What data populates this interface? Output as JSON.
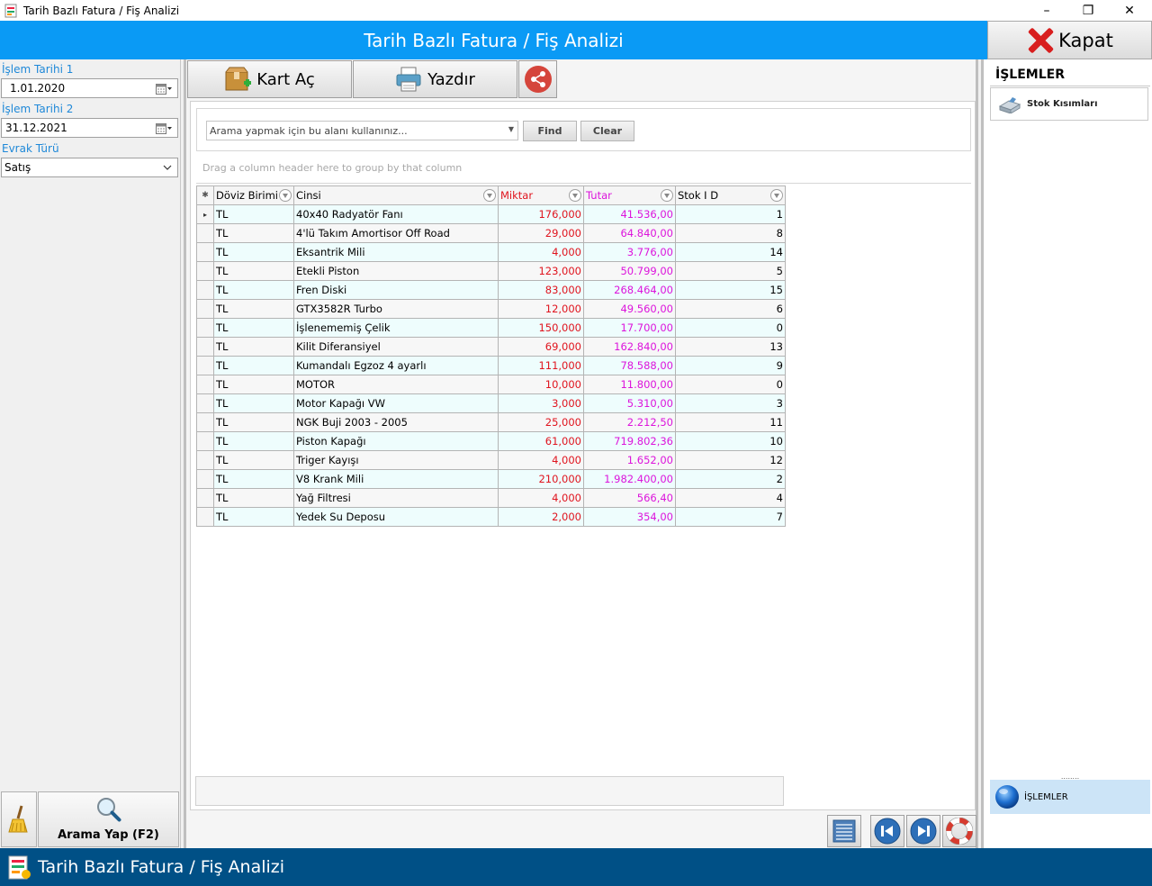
{
  "window": {
    "title": "Tarih Bazlı Fatura / Fiş Analizi",
    "minimize": "–",
    "restore": "❐",
    "close": "✕"
  },
  "header": {
    "title": "Tarih Bazlı Fatura / Fiş Analizi",
    "close_label": "Kapat"
  },
  "filters": {
    "date1_label": "İşlem Tarihi 1",
    "date1_value": "1.01.2020",
    "date2_label": "İşlem Tarihi 2",
    "date2_value": "31.12.2021",
    "doc_type_label": "Evrak Türü",
    "doc_type_value": "Satış",
    "search_button": "Arama Yap (F2)"
  },
  "toolbar": {
    "open_card": "Kart Aç",
    "print": "Yazdır"
  },
  "find_panel": {
    "placeholder": "Arama yapmak için bu alanı kullanınız...",
    "find": "Find",
    "clear": "Clear"
  },
  "group_panel": {
    "hint": "Drag a column header here to group by that column"
  },
  "grid": {
    "columns": [
      "Döviz Birimi",
      "Cinsi",
      "Miktar",
      "Tutar",
      "Stok I D"
    ],
    "rows": [
      [
        "TL",
        "40x40 Radyatör Fanı",
        "176,000",
        "41.536,00",
        "1"
      ],
      [
        "TL",
        "4'lü Takım Amortisor Off Road",
        "29,000",
        "64.840,00",
        "8"
      ],
      [
        "TL",
        "Eksantrik Mili",
        "4,000",
        "3.776,00",
        "14"
      ],
      [
        "TL",
        "Etekli Piston",
        "123,000",
        "50.799,00",
        "5"
      ],
      [
        "TL",
        "Fren Diski",
        "83,000",
        "268.464,00",
        "15"
      ],
      [
        "TL",
        "GTX3582R Turbo",
        "12,000",
        "49.560,00",
        "6"
      ],
      [
        "TL",
        "İşlenememiş Çelik",
        "150,000",
        "17.700,00",
        "0"
      ],
      [
        "TL",
        "Kilit Diferansiyel",
        "69,000",
        "162.840,00",
        "13"
      ],
      [
        "TL",
        "Kumandalı Egzoz 4 ayarlı",
        "111,000",
        "78.588,00",
        "9"
      ],
      [
        "TL",
        "MOTOR",
        "10,000",
        "11.800,00",
        "0"
      ],
      [
        "TL",
        "Motor Kapağı VW",
        "3,000",
        "5.310,00",
        "3"
      ],
      [
        "TL",
        "NGK Buji 2003 - 2005",
        "25,000",
        "2.212,50",
        "11"
      ],
      [
        "TL",
        "Piston Kapağı",
        "61,000",
        "719.802,36",
        "10"
      ],
      [
        "TL",
        "Triger Kayışı",
        "4,000",
        "1.652,00",
        "12"
      ],
      [
        "TL",
        "V8 Krank Mili",
        "210,000",
        "1.982.400,00",
        "2"
      ],
      [
        "TL",
        "Yağ Filtresi",
        "4,000",
        "566,40",
        "4"
      ],
      [
        "TL",
        "Yedek Su Deposu",
        "2,000",
        "354,00",
        "7"
      ]
    ]
  },
  "right_panel": {
    "heading": "İŞLEMLER",
    "item_stock": "Stok Kısımları",
    "grip": "........",
    "group_label": "İŞLEMLER"
  },
  "taskbar": {
    "title": "Tarih Bazlı Fatura / Fiş Analizi"
  },
  "colors": {
    "header_blue": "#0a9af5",
    "taskbar_blue": "#005086",
    "label_blue": "#1e88d8",
    "quantity_red": "#e0141e",
    "amount_magenta": "#dc14dc"
  }
}
